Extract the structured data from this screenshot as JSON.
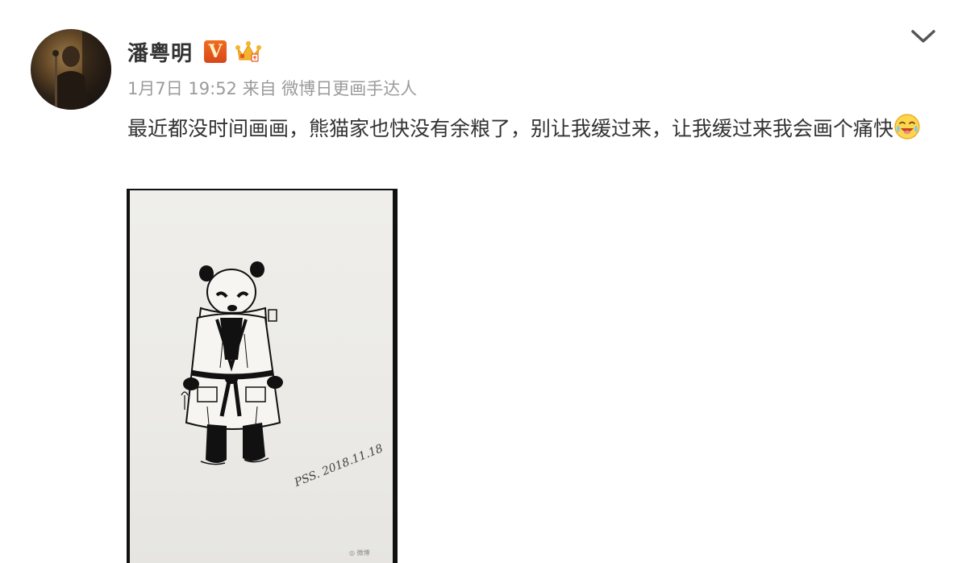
{
  "post": {
    "username": "潘粤明",
    "verified_badge": "V",
    "badge_icons": [
      "verified-v-icon",
      "vip-crown-icon"
    ],
    "timestamp": "1月7日 19:52",
    "source_prefix": "来自",
    "source": "微博日更画手达人",
    "text_before_emoji": "最近都没时间画画，熊猫家也快没有余粮了，别让我缓过来，让我缓过来我会画个痛快",
    "emoji": "laugh-tears-emoji",
    "menu_icon": "chevron-down-icon"
  },
  "image": {
    "subject": "panda-drawing",
    "signature": "PSS. 2018.11.18",
    "watermark": "◎ 微博"
  },
  "colors": {
    "text": "#333333",
    "meta": "#9b9b9b",
    "vip_orange": "#e8561c",
    "crown_gold": "#f5b52b"
  }
}
